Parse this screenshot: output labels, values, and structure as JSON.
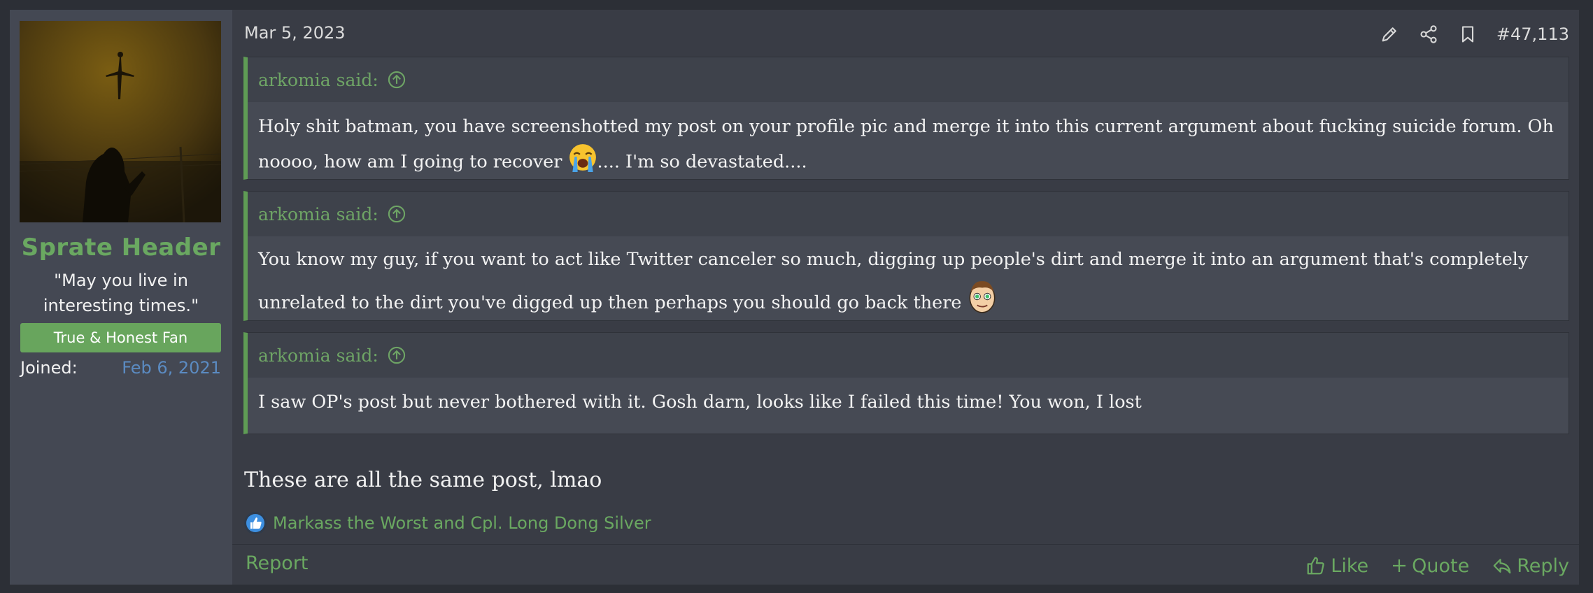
{
  "user": {
    "name": "Sprate Header",
    "title": "\"May you live in interesting times.\"",
    "banner": "True & Honest Fan",
    "joined_label": "Joined:",
    "joined_date": "Feb 6, 2021",
    "avatar_icon": "silhouette-photo"
  },
  "post": {
    "date": "Mar 5, 2023",
    "number": "#47,113",
    "quotes": [
      {
        "attribution": "arkomia said:",
        "text_before_emoji": "Holy shit batman, you have screenshotted my post on your profile pic and merge it into this current argument about fucking suicide forum. Oh noooo, how am I going to recover ",
        "emoji_icon": "crying-face-emoji",
        "text_after_emoji": ".... I'm so devastated...."
      },
      {
        "attribution": "arkomia said:",
        "text_before_emoji": "You know my guy, if you want to act like Twitter canceler so much, digging up people's dirt and merge it into an argument that's completely unrelated to the dirt you've digged up then perhaps you should go back there ",
        "emoji_icon": "cartoon-face-emoji",
        "text_after_emoji": ""
      },
      {
        "attribution": "arkomia said:",
        "text_before_emoji": "I saw OP's post but never bothered with it. Gosh darn, looks like I failed this time! You won, I lost",
        "emoji_icon": "",
        "text_after_emoji": ""
      }
    ],
    "message": "These are all the same post, lmao",
    "reactions": "Markass the Worst and Cpl. Long Dong Silver",
    "reaction_icon": "like-reaction-icon"
  },
  "actions": {
    "report": "Report",
    "like": "Like",
    "quote": "Quote",
    "reply": "Reply"
  },
  "colors": {
    "accent_green": "#6aa861",
    "link_blue": "#5b8bc2",
    "background": "#393c45",
    "sidebar": "#444853"
  }
}
